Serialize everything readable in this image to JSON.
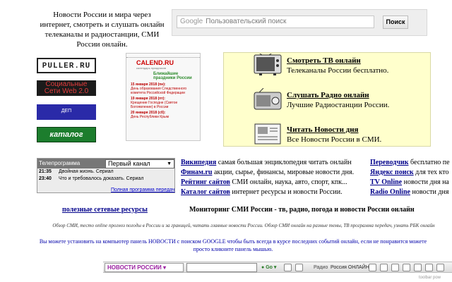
{
  "header": {
    "tagline": "Новости России и мира через интернет, смотреть и слушать онлайн телеканалы и радиостанции, СМИ России онлайн.",
    "search": {
      "google_label": "Google",
      "placeholder": "Пользовательский поиск",
      "button_label": "Поиск"
    }
  },
  "badges": {
    "puller": "PULLER.RU",
    "social": "Социальные Сети Web 2.0",
    "dep": "ДЕП",
    "catalog": "каталог сайтов"
  },
  "calendar": {
    "brand": "CALEND.RU",
    "sub": "календарь праздников",
    "holidays_label": "Ближайшие праздники России",
    "events": [
      {
        "date": "15 января 2018 (пн):",
        "text": "День образования Следственного комитета Российской Федерации"
      },
      {
        "date": "19 января 2018 (пт):",
        "text": "Крещение Господне (Святое Богоявление) в России"
      },
      {
        "date": "20 января 2018 (сб):",
        "text": "День Республики Крым"
      }
    ]
  },
  "services": [
    {
      "icon": "tv-icon",
      "title": "Смотреть ТВ онлайн",
      "desc": "Телеканалы России бесплатно."
    },
    {
      "icon": "radio-icon",
      "title": "Слушать Радио онлайн",
      "desc": "Лучшие Радиостанции России."
    },
    {
      "icon": "newspaper-icon",
      "title": "Читать Новости дня",
      "desc": "Все Новости России в СМИ."
    }
  ],
  "tv_program": {
    "header": "Телепрограмма",
    "channel": "Первый канал",
    "rows": [
      {
        "time": "21:35",
        "title": "Двойная жизнь. Сериал"
      },
      {
        "time": "23:40",
        "title": "Что и требовалось доказать. Сериал"
      }
    ],
    "full_link": "Полная программа передач"
  },
  "links_left": [
    {
      "link": "Википедия",
      "text": " самая большая энциклопедия читать онлайн"
    },
    {
      "link": "Финам.ru",
      "text": " акции, сырье, финансы, мировые новости дня."
    },
    {
      "link": "Рейтинг сайтов",
      "text": " СМИ онлайн, наука, авто, спорт, кпк..."
    },
    {
      "link": "Каталог сайтов",
      "text": " интернет ресурсы и новости России."
    }
  ],
  "links_right": [
    {
      "link": "Переводчик",
      "text": " бесплатно пе"
    },
    {
      "link": "Яндекс поиск",
      "text": " для тех кто"
    },
    {
      "link": "TV Online",
      "text": " новости дня на"
    },
    {
      "link": "Radio Online",
      "text": " новости дня"
    }
  ],
  "useful_resources": "полезные сетевые ресурсы",
  "monitoring_title": "Мониторинг СМИ России - тв, радио, погода и новости России онлайн",
  "obzor": "Обзор СМИ, тесто online прогноз погоды в России и за границей, читать главные новости России. Обзор СМИ онлайн на разные темы, ТВ программа передач, узнать РБК онлайн",
  "install_text": "Вы можете установить на компьютер панель НОВОСТИ с поиском GOOGLE чтобы быть всегда в курсе последних событий онлайн, если не понравится можете просто кликните панель мышью.",
  "toolbar": {
    "news_label": "НОВОСТИ РОССИИ",
    "go_label": "Go",
    "radio_label": "Радио",
    "russia_label": "Россия ОНЛАЙН",
    "footer": "toolbar pow"
  }
}
